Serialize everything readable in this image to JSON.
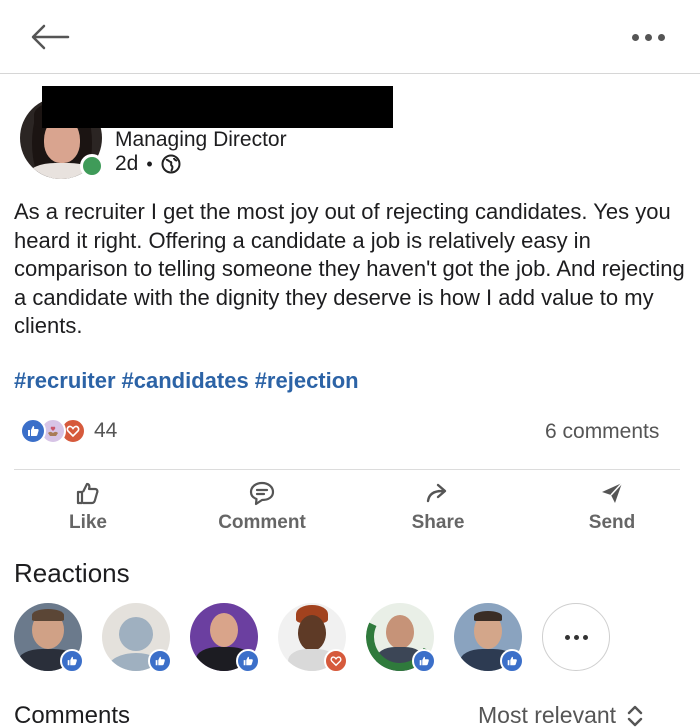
{
  "post": {
    "headline": "Managing Director",
    "age": "2d",
    "separator": "•",
    "body": "As a recruiter I get the most joy out of rejecting candidates. Yes you heard it right. Offering a candidate a job is relatively easy in comparison to telling someone they haven't got the job. And rejecting a candidate with the dignity they deserve is how I add value to my clients.",
    "hashtags": [
      "#recruiter",
      "#candidates",
      "#rejection"
    ]
  },
  "stats": {
    "reaction_count": "44",
    "comments": "6 comments"
  },
  "actions": {
    "like": "Like",
    "comment": "Comment",
    "share": "Share",
    "send": "Send"
  },
  "reactions_section": {
    "title": "Reactions",
    "badges": [
      "like",
      "like",
      "like",
      "love",
      "like",
      "like"
    ]
  },
  "comments_section": {
    "title": "Comments",
    "sort_label": "Most relevant"
  },
  "colors": {
    "hashtag": "#2c63a6",
    "like": "#3b6fc9",
    "love": "#d65a3c",
    "online": "#3f9b59"
  },
  "icons": [
    "back-arrow-icon",
    "more-icon",
    "globe-icon",
    "like-icon",
    "comment-icon",
    "share-icon",
    "send-icon",
    "sort-icon"
  ]
}
